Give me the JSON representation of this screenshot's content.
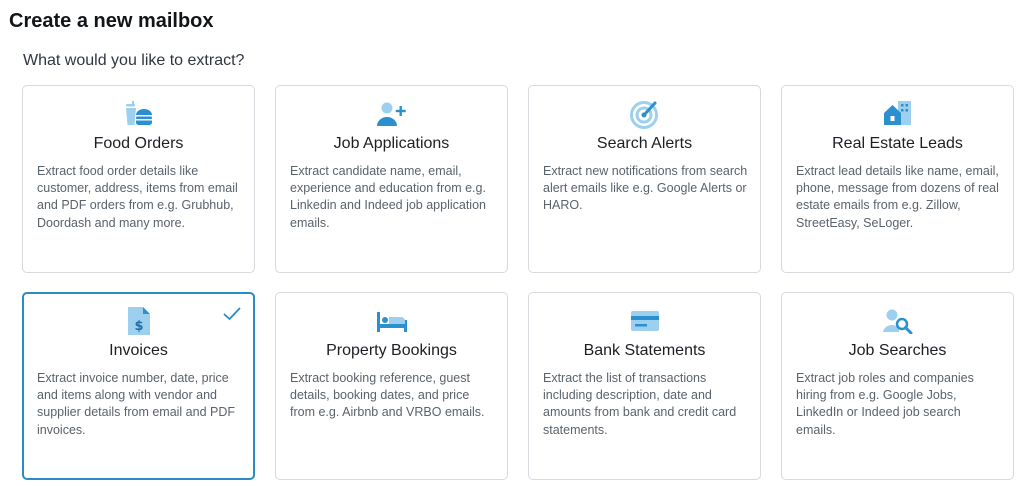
{
  "header": {
    "title": "Create a new mailbox",
    "subtitle": "What would you like to extract?"
  },
  "colors": {
    "accent": "#2a8bc9",
    "icon_dark": "#2b8fd0",
    "icon_light": "#9dd0ee"
  },
  "cards": [
    {
      "title": "Food Orders",
      "icon": "food-icon",
      "description": "Extract food order details like customer, address, items from email and PDF orders from e.g. Grubhub, Doordash and many more.",
      "selected": false
    },
    {
      "title": "Job Applications",
      "icon": "add-person-icon",
      "description": "Extract candidate name, email, experience and education from e.g. Linkedin and Indeed job application emails.",
      "selected": false
    },
    {
      "title": "Search Alerts",
      "icon": "radar-icon",
      "description": "Extract new notifications from search alert emails like e.g. Google Alerts or HARO.",
      "selected": false
    },
    {
      "title": "Real Estate Leads",
      "icon": "building-icon",
      "description": "Extract lead details like name, email, phone, message from dozens of real estate emails from e.g. Zillow, StreetEasy, SeLoger.",
      "selected": false
    },
    {
      "title": "Invoices",
      "icon": "invoice-icon",
      "description": "Extract invoice number, date, price and items along with vendor and supplier details from email and PDF invoices.",
      "selected": true
    },
    {
      "title": "Property Bookings",
      "icon": "bed-icon",
      "description": "Extract booking reference, guest details, booking dates, and price from e.g. Airbnb and VRBO emails.",
      "selected": false
    },
    {
      "title": "Bank Statements",
      "icon": "credit-card-icon",
      "description": "Extract the list of transactions including description, date and amounts from bank and credit card statements.",
      "selected": false
    },
    {
      "title": "Job Searches",
      "icon": "person-search-icon",
      "description": "Extract job roles and companies hiring from e.g. Google Jobs, LinkedIn or Indeed job search emails.",
      "selected": false
    }
  ]
}
